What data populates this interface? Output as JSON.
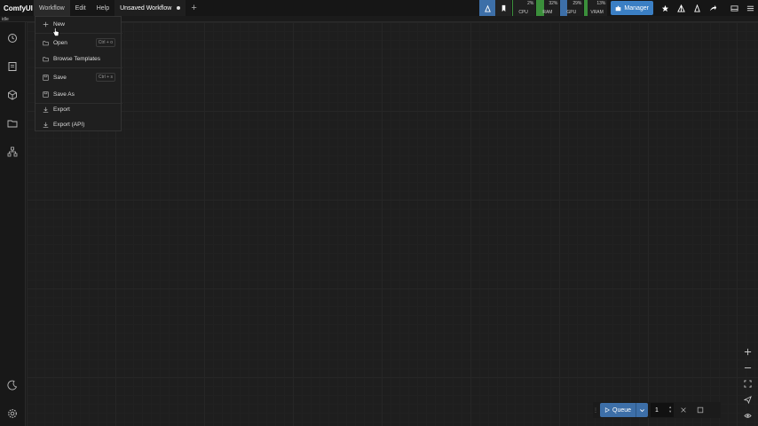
{
  "app": {
    "name": "ComfyUI",
    "status": "idle"
  },
  "menubar": {
    "workflow": "Workflow",
    "edit": "Edit",
    "help": "Help"
  },
  "tab": {
    "title": "Unsaved Workflow",
    "add": "+"
  },
  "monitor": {
    "cpu": {
      "label": "CPU",
      "value": "2%"
    },
    "ram": {
      "label": "RAM",
      "value": "32%"
    },
    "gpu": {
      "label": "GPU",
      "value": "29%"
    },
    "vram": {
      "label": "VRAM",
      "value": "13%"
    }
  },
  "toolbar": {
    "manager_label": "Manager"
  },
  "workflow_menu": {
    "new": {
      "label": "New",
      "icon": "plus-icon"
    },
    "open": {
      "label": "Open",
      "shortcut": "Ctrl + o",
      "icon": "folder-open-icon"
    },
    "browse": {
      "label": "Browse Templates",
      "icon": "folder-icon"
    },
    "save": {
      "label": "Save",
      "shortcut": "Ctrl + s",
      "icon": "save-icon"
    },
    "save_as": {
      "label": "Save As",
      "icon": "save-as-icon"
    },
    "export": {
      "label": "Export",
      "icon": "download-icon"
    },
    "export_api": {
      "label": "Export (API)",
      "icon": "download-icon"
    }
  },
  "queue": {
    "label": "Queue",
    "count": "1"
  },
  "colors": {
    "accent": "#3d6fa8",
    "manager": "#3b7fc4",
    "cpu": "#3b8f3b",
    "gpu": "#3d6fa8"
  }
}
